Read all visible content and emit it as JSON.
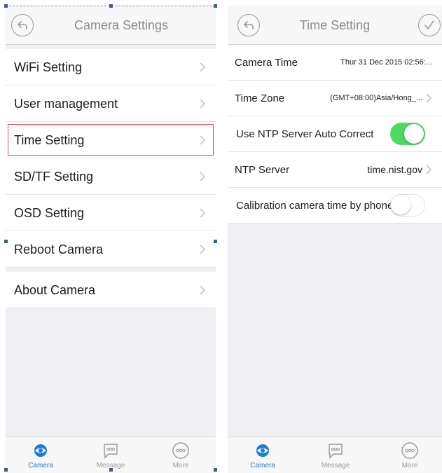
{
  "left": {
    "title": "Camera Settings",
    "back_icon": "back-arrow-icon",
    "group1": [
      "WiFi Setting",
      "User management",
      "Time Setting",
      "SD/TF Setting",
      "OSD Setting"
    ],
    "group2": [
      "Reboot Camera"
    ],
    "group3": [
      "About Camera"
    ],
    "highlighted_item": "Time Setting",
    "tabs": [
      {
        "label": "Camera",
        "icon": "camera-eye-icon",
        "active": true
      },
      {
        "label": "Message",
        "icon": "message-bubble-icon",
        "active": false
      },
      {
        "label": "More",
        "icon": "more-icon",
        "active": false
      }
    ]
  },
  "right": {
    "title": "Time Setting",
    "back_icon": "back-arrow-icon",
    "confirm_icon": "checkmark-icon",
    "rows": {
      "camera_time_label": "Camera Time",
      "camera_time_value": "Thur 31 Dec 2015  02:56:...",
      "time_zone_label": "Time Zone",
      "time_zone_value": "(GMT+08:00)Asia/Hong_...",
      "ntp_auto_label": "Use NTP Server Auto Correct",
      "ntp_auto_on": true,
      "ntp_server_label": "NTP Server",
      "ntp_server_value": "time.nist.gov",
      "calibration_label": "Calibration camera time by phone",
      "calibration_on": false
    },
    "tabs": [
      {
        "label": "Camera",
        "icon": "camera-eye-icon",
        "active": true
      },
      {
        "label": "Message",
        "icon": "message-bubble-icon",
        "active": false
      },
      {
        "label": "More",
        "icon": "more-icon",
        "active": false
      }
    ]
  },
  "colors": {
    "accent_blue": "#1e7ad9",
    "toggle_green": "#4cd964",
    "highlight_red": "#e04848",
    "background": "#efeff4"
  }
}
